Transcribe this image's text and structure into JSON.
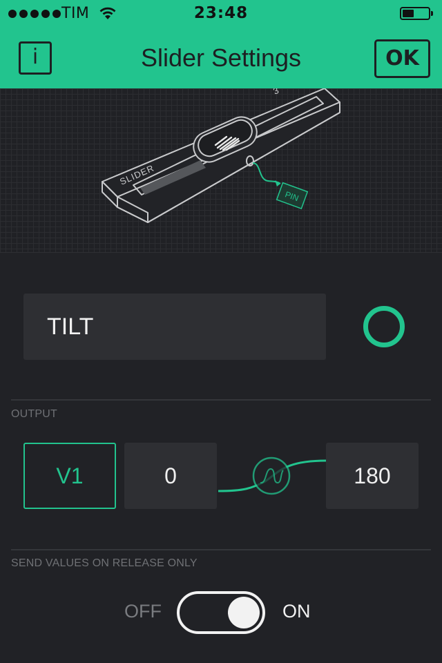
{
  "status_bar": {
    "carrier": "TIM",
    "time": "23:48",
    "signal_bars": 5,
    "battery_level": 0.45
  },
  "nav": {
    "info_label": "i",
    "title": "Slider Settings",
    "ok_label": "OK"
  },
  "illustration": {
    "slider_label": "SLIDER",
    "pin_label": "PIN",
    "scale_label": "3"
  },
  "widget": {
    "name_value": "TILT",
    "color": "#22c48e"
  },
  "output": {
    "section_label": "OUTPUT",
    "pin": "V1",
    "min": "0",
    "max": "180"
  },
  "release": {
    "section_label": "SEND VALUES ON RELEASE ONLY",
    "off_label": "OFF",
    "on_label": "ON",
    "state": "on"
  },
  "colors": {
    "accent": "#22c48e",
    "background": "#212226",
    "field": "#2e2f33"
  }
}
